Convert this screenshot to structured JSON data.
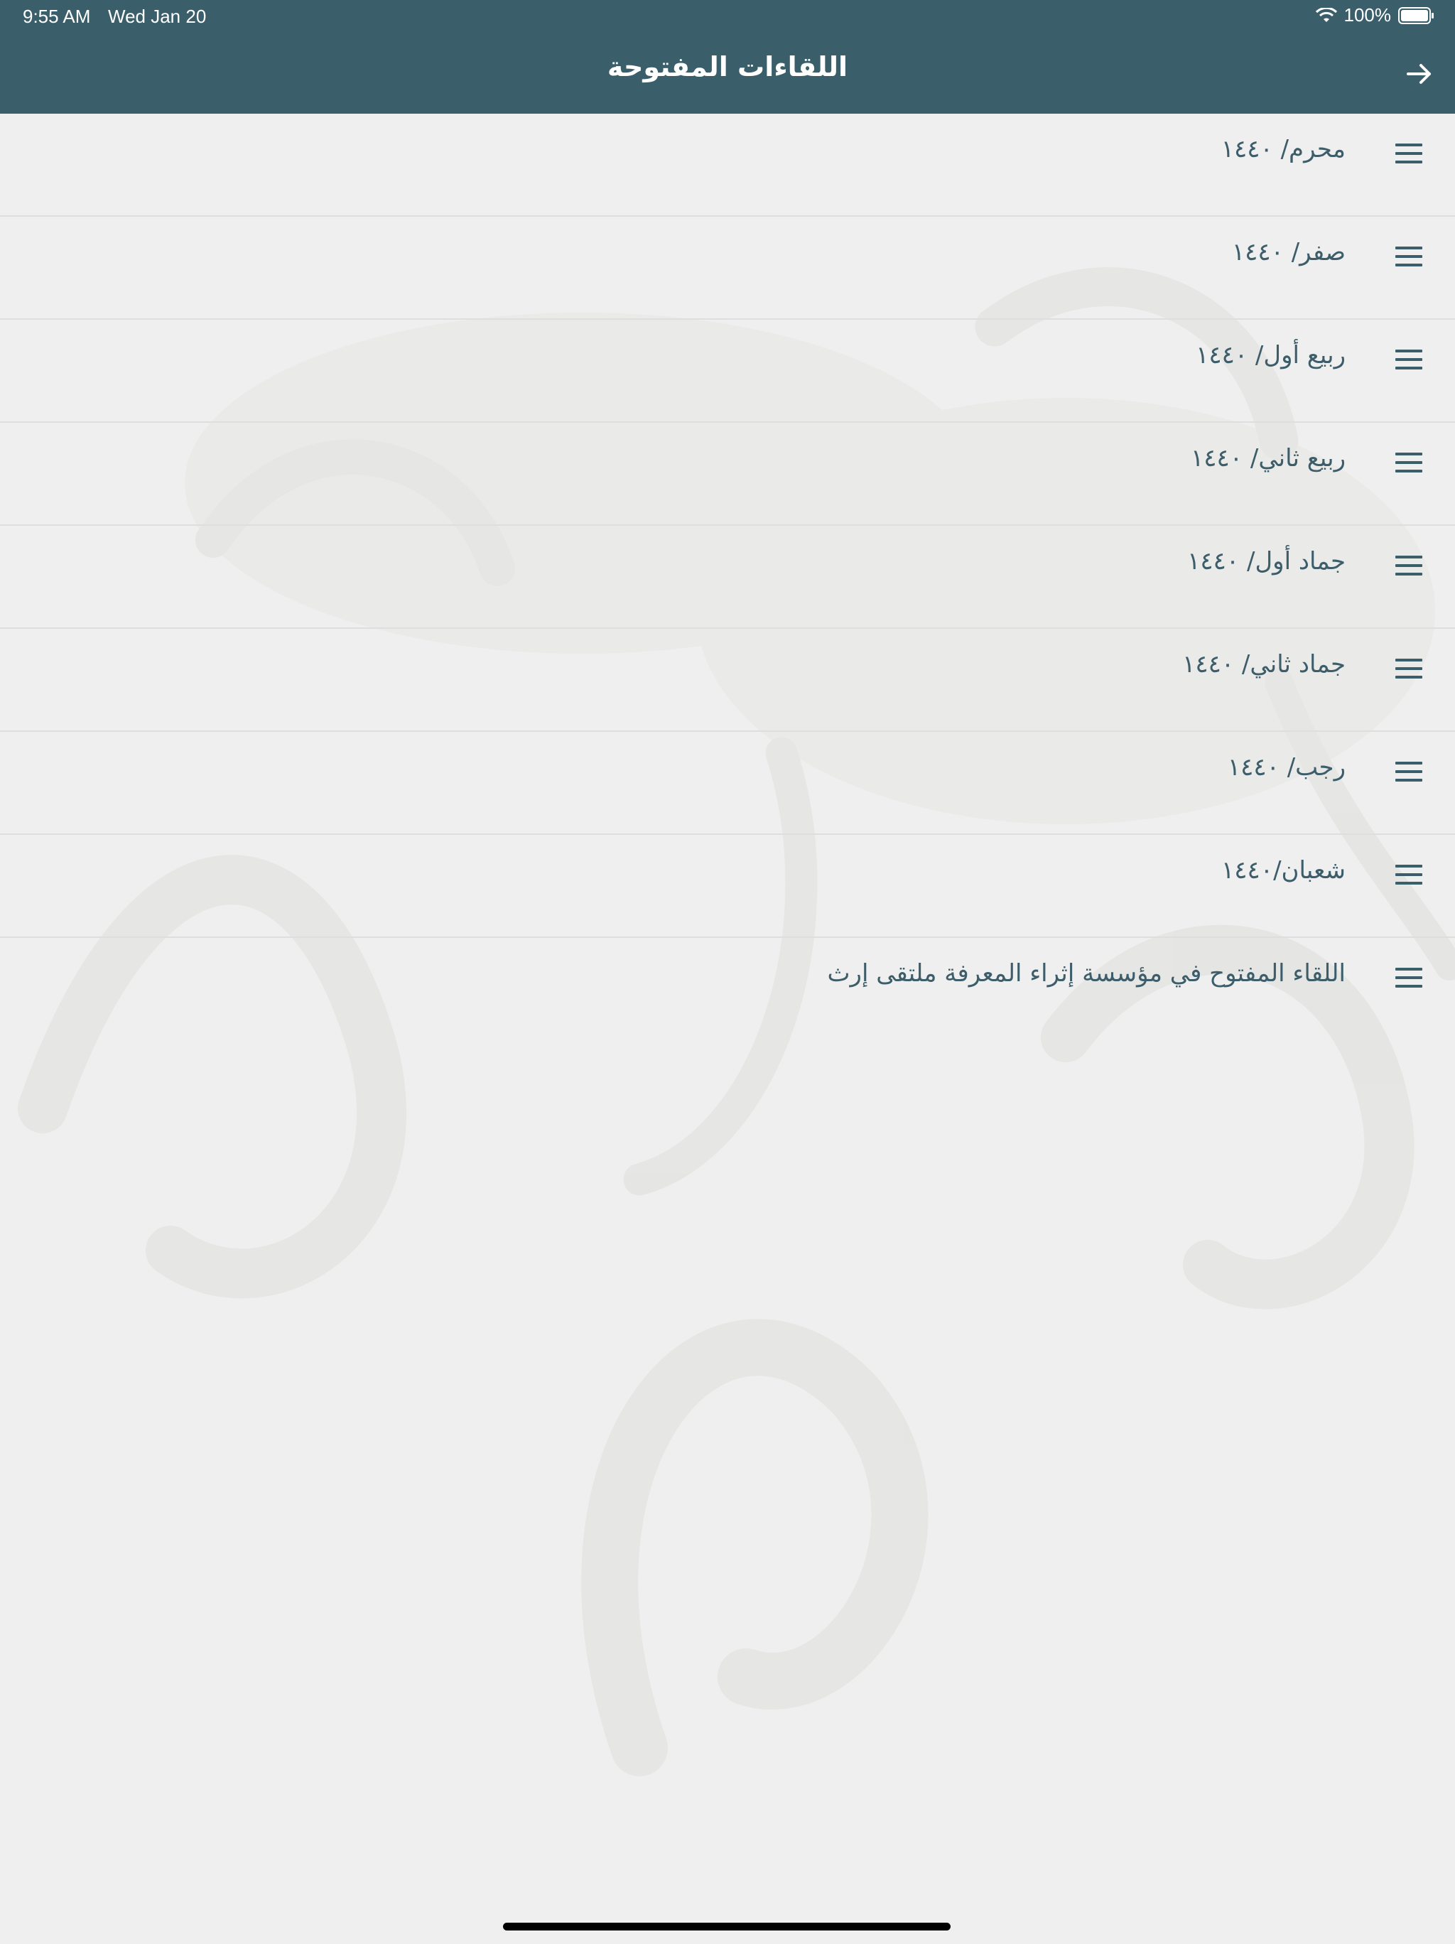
{
  "status_bar": {
    "time": "9:55 AM",
    "date": "Wed Jan 20",
    "battery": "100%"
  },
  "header": {
    "title": "اللقاءات المفتوحة"
  },
  "list": {
    "items": [
      {
        "label": "محرم/ ١٤٤٠"
      },
      {
        "label": "صفر/ ١٤٤٠"
      },
      {
        "label": "ربيع أول/ ١٤٤٠"
      },
      {
        "label": "ربيع ثاني/ ١٤٤٠"
      },
      {
        "label": "جماد أول/ ١٤٤٠"
      },
      {
        "label": "جماد ثاني/ ١٤٤٠"
      },
      {
        "label": "رجب/ ١٤٤٠"
      },
      {
        "label": "شعبان/١٤٤٠"
      },
      {
        "label": "اللقاء المفتوح في مؤسسة إثراء المعرفة ملتقى إرث"
      }
    ]
  },
  "colors": {
    "header_bg": "#3a5f6b",
    "page_bg": "#efefef",
    "text": "#3c5d69"
  },
  "icons": {
    "back": "arrow-right-icon",
    "item": "menu-icon",
    "wifi": "wifi-icon",
    "battery": "battery-icon"
  }
}
